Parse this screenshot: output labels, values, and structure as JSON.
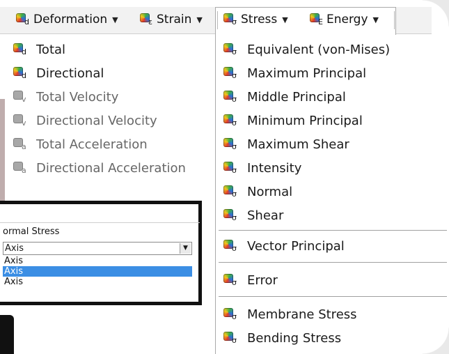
{
  "toolbar": {
    "items": [
      {
        "label": "Deformation",
        "icon": "deformation-icon",
        "sub": "d"
      },
      {
        "label": "Strain",
        "icon": "strain-icon",
        "sub": "ε"
      },
      {
        "label": "Stress",
        "icon": "stress-icon",
        "sub": "σ"
      },
      {
        "label": "Energy",
        "icon": "energy-icon",
        "sub": "E"
      }
    ],
    "caret": "▼"
  },
  "deformation_menu": [
    {
      "label": "Total",
      "sub": "d",
      "enabled": true
    },
    {
      "label": "Directional",
      "sub": "d",
      "enabled": true
    },
    {
      "label": "Total Velocity",
      "sub": "v",
      "enabled": false
    },
    {
      "label": "Directional Velocity",
      "sub": "v",
      "enabled": false
    },
    {
      "label": "Total Acceleration",
      "sub": "a",
      "enabled": false
    },
    {
      "label": "Directional Acceleration",
      "sub": "a",
      "enabled": false
    }
  ],
  "stress_menu": {
    "sub": "σ",
    "group1": [
      "Equivalent (von-Mises)",
      "Maximum Principal",
      "Middle Principal",
      "Minimum Principal",
      "Maximum Shear",
      "Intensity",
      "Normal",
      "Shear"
    ],
    "group2": [
      "Vector Principal"
    ],
    "group3": [
      "Error"
    ],
    "group4": [
      "Membrane Stress",
      "Bending Stress"
    ]
  },
  "detail_panel": {
    "type_label": "ormal Stress",
    "selected_value": "Axis",
    "options": [
      "Axis",
      "Axis",
      "Axis"
    ],
    "highlighted_index": 1
  },
  "colors": {
    "highlight": "#3b8ee4",
    "toolbar_bg": "#f2f2f2",
    "disabled_text": "#666666"
  }
}
